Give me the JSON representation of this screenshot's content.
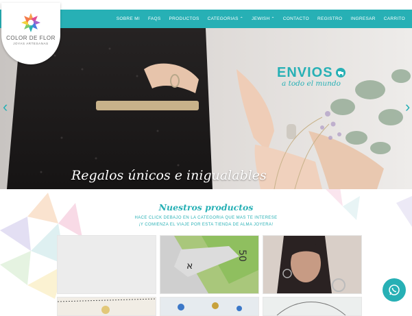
{
  "brand": {
    "name": "COLOR DE FLOR",
    "tagline": "JOYAS ARTESANAS"
  },
  "nav": {
    "items": [
      {
        "label": "SOBRE MI"
      },
      {
        "label": "FAQS"
      },
      {
        "label": "PRODUCTOS"
      },
      {
        "label": "CATEGORIAS",
        "has_caret": true
      },
      {
        "label": "JEWISH",
        "has_caret": true
      },
      {
        "label": "CONTACTO"
      },
      {
        "label": "REGISTRO"
      },
      {
        "label": "INGRESAR"
      },
      {
        "label": "CARRITO"
      }
    ]
  },
  "hero": {
    "title": "Regalos únicos e inigualables",
    "promo_main": "ENVIOS",
    "promo_sub": "a todo el mundo"
  },
  "products_section": {
    "title": "Nuestros productos",
    "subtitle_line1": "HACE CLICK DEBAJO EN LA CATEGORIA QUE MAS TE INTERESE",
    "subtitle_line2": "¡Y COMIENZA EL VIAJE POR ESTA TIENDA DE ALMA JOYERA!",
    "banknote_text": "50"
  },
  "colors": {
    "accent": "#27b0b5",
    "white": "#ffffff"
  },
  "icons": [
    "brand-flower-icon",
    "truck-icon",
    "chevron-left-icon",
    "chevron-right-icon",
    "whatsapp-icon",
    "caret-down-icon"
  ]
}
